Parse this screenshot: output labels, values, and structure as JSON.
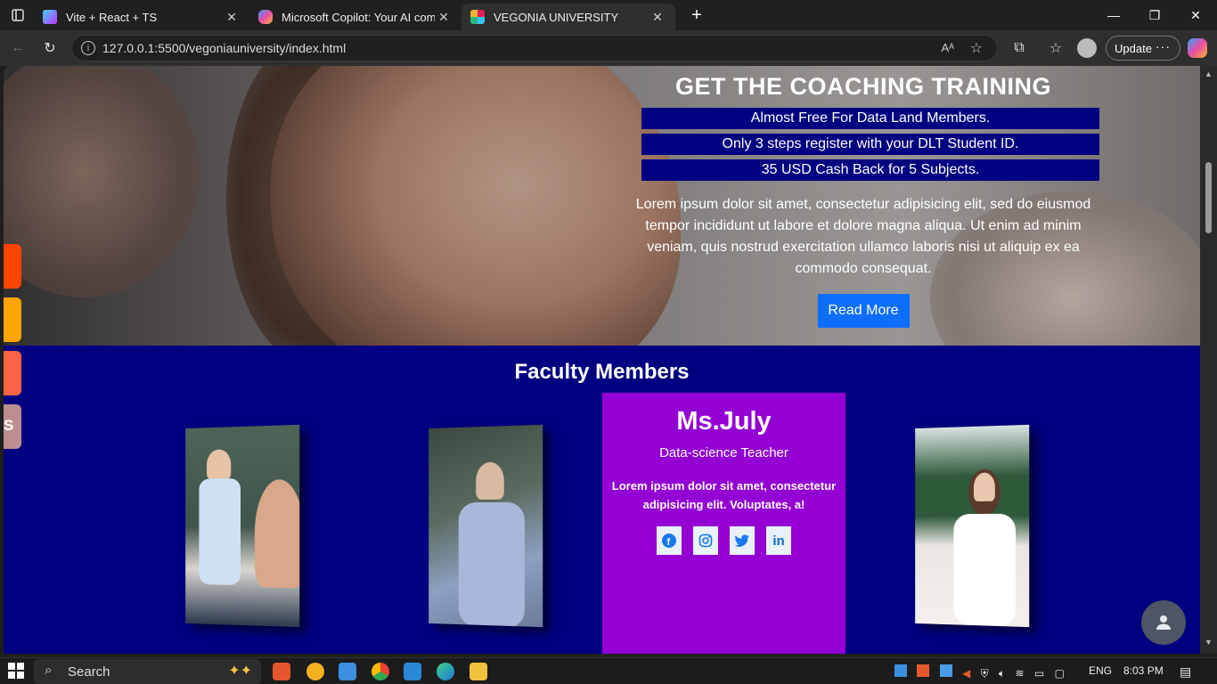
{
  "browser": {
    "tabs": [
      {
        "label": "Vite + React + TS",
        "favicon_color": "#a855f7",
        "active": false
      },
      {
        "label": "Microsoft Copilot: Your AI compa",
        "favicon_color": "#3b82f6",
        "active": false
      },
      {
        "label": "VEGONIA UNIVERSITY",
        "favicon_color": "#e01e5a",
        "active": true
      }
    ],
    "new_tab_icon": "plus-icon",
    "address": "127.0.0.1:5500/vegoniauniversity/index.html",
    "update_label": "Update",
    "more_label": "···"
  },
  "hero": {
    "title": "GET THE COACHING TRAINING",
    "bars": [
      "Almost Free For Data Land Members.",
      "Only 3 steps register with your DLT Student ID.",
      "35 USD Cash Back for 5 Subjects."
    ],
    "body": "Lorem ipsum dolor sit amet, consectetur adipisicing elit, sed do eiusmod tempor incididunt ut labore et dolore magna aliqua. Ut enim ad minim veniam, quis nostrud exercitation ullamco laboris nisi ut aliquip ex ea commodo consequat.",
    "button": "Read More"
  },
  "side_tabs": [
    {
      "color": "#ff4500",
      "label": ""
    },
    {
      "color": "#ffa500",
      "label": ""
    },
    {
      "color": "#ff6347",
      "label": ""
    },
    {
      "color": "#bc8f8f",
      "label": "S"
    }
  ],
  "faculty": {
    "title": "Faculty Members",
    "featured": {
      "name": "Ms.July",
      "role": "Data-science Teacher",
      "text": "Lorem ipsum dolor sit amet, consectetur adipisicing elit. Voluptates, a!",
      "socials": [
        "facebook-icon",
        "instagram-icon",
        "twitter-icon",
        "linkedin-icon"
      ]
    }
  },
  "taskbar": {
    "search_placeholder": "Search",
    "language": "ENG",
    "time": "8:03 PM"
  },
  "colors": {
    "navy": "#000080",
    "card_purple": "#9400d3",
    "button_blue": "#0d6efd"
  }
}
